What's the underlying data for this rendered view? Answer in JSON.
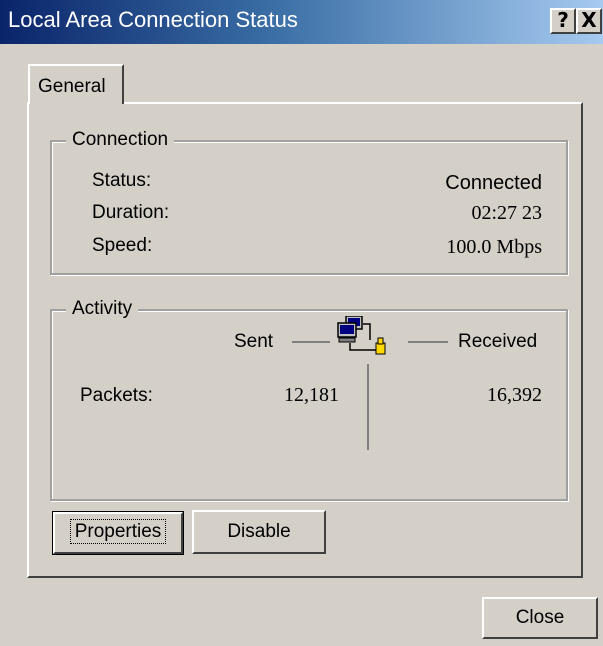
{
  "window": {
    "title": "Local Area Connection Status",
    "help_button": "?",
    "close_button": "X"
  },
  "tabs": [
    {
      "label": "General"
    }
  ],
  "connection": {
    "legend": "Connection",
    "status_label": "Status:",
    "status_value": "Connected",
    "duration_label": "Duration:",
    "duration_value": "02:27 23",
    "speed_label": "Speed:",
    "speed_value": "100.0 Mbps"
  },
  "activity": {
    "legend": "Activity",
    "sent_label": "Sent",
    "received_label": "Received",
    "packets_label": "Packets:",
    "packets_sent": "12,181",
    "packets_received": "16,392",
    "icon": "network-computers-icon"
  },
  "buttons": {
    "properties": "Properties",
    "disable": "Disable",
    "close": "Close"
  },
  "colors": {
    "titlebar_start": "#0a246a",
    "titlebar_end": "#a6caf0",
    "face": "#d4d0c8"
  }
}
